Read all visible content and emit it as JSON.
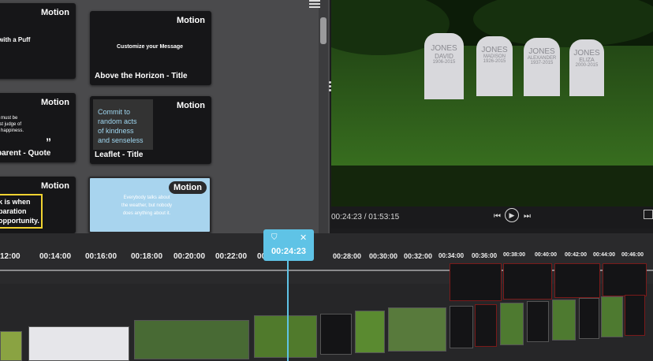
{
  "templates": {
    "badge": "Motion",
    "cards": [
      {
        "title": "",
        "snippet": "with a Puff"
      },
      {
        "title": "Above the Horizon - Title",
        "snippet": "Customize your Message"
      },
      {
        "title": "parent - Quote",
        "snippet": "n must be\nest judge of\nn happiness."
      },
      {
        "title": "Leaflet - Title",
        "snippet": "Commit to\nrandom acts\nof kindness\nand senseless"
      },
      {
        "title": "",
        "snippet": "k is when\nparation\nopportunity."
      },
      {
        "title": "",
        "snippet": "Everybody talks about\nthe weather, but nobody\ndoes anything about it."
      }
    ]
  },
  "preview": {
    "time_display": "00:24:23 / 01:53:15",
    "gravestones": [
      {
        "name": "JONES",
        "first": "DAVID",
        "years": "1906-2015"
      },
      {
        "name": "JONES",
        "first": "MADISON",
        "years": "1926-2015"
      },
      {
        "name": "JONES",
        "first": "ALEXANDER",
        "years": "1937-2015"
      },
      {
        "name": "JONES",
        "first": "ELIZA",
        "years": "2000-2015"
      }
    ]
  },
  "timeline": {
    "playhead_time": "00:24:23",
    "ticks": [
      "12:00",
      "00:14:00",
      "00:16:00",
      "00:18:00",
      "00:20:00",
      "00:22:00",
      "00:26:00",
      "00:28:00",
      "00:30:00",
      "00:32:00",
      "00:34:00",
      "00:36:00",
      "00:38:00",
      "00:40:00",
      "00:42:00",
      "00:44:00",
      "00:46:00"
    ]
  },
  "colors": {
    "accent": "#5fc3e6",
    "panel": "#4a4a4c",
    "grass": "#3e7a22"
  }
}
